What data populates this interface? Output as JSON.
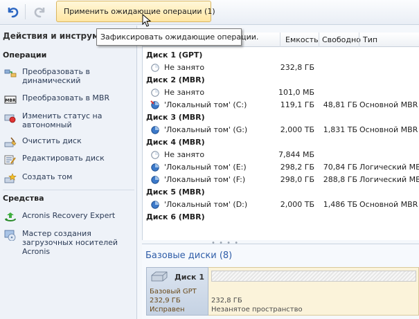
{
  "toolbar": {
    "apply_label": "Применить ожидающие операции (1)",
    "tooltip": "Зафиксировать ожидающие операции."
  },
  "sidebar": {
    "title": "Действия и инструменты",
    "sections": [
      {
        "title": "Операции",
        "items": [
          {
            "label": "Преобразовать в динамический",
            "icon": "convert-dynamic-icon"
          },
          {
            "label": "Преобразовать в MBR",
            "icon": "mbr-icon"
          },
          {
            "label": "Изменить статус на автономный",
            "icon": "offline-status-icon"
          },
          {
            "label": "Очистить диск",
            "icon": "clean-disk-icon"
          },
          {
            "label": "Редактировать диск",
            "icon": "edit-disk-icon"
          },
          {
            "label": "Создать том",
            "icon": "create-volume-icon"
          }
        ]
      },
      {
        "title": "Средства",
        "items": [
          {
            "label": "Acronis Recovery Expert",
            "icon": "recovery-expert-icon"
          },
          {
            "label": "Мастер создания загрузочных носителей Acronis",
            "icon": "boot-media-icon"
          }
        ]
      }
    ]
  },
  "columns": {
    "capacity": "Емкость",
    "free": "Свободно",
    "type": "Тип"
  },
  "rows": [
    {
      "kind": "disk",
      "name": "Диск 1 (GPT)"
    },
    {
      "kind": "vol",
      "name": "Не занято",
      "capacity": "232,8 ГБ",
      "free": "",
      "type": "",
      "icon": "unallocated-icon"
    },
    {
      "kind": "disk",
      "name": "Диск 2 (MBR)"
    },
    {
      "kind": "vol",
      "name": "Не занято",
      "capacity": "101,0 МБ",
      "free": "",
      "type": "",
      "icon": "unallocated-icon"
    },
    {
      "kind": "vol",
      "name": "'Локальный том' (C:)",
      "capacity": "119,1 ГБ",
      "free": "48,81 ГБ",
      "type": "Основной MBR",
      "icon": "system-volume-icon"
    },
    {
      "kind": "disk",
      "name": "Диск 3 (MBR)"
    },
    {
      "kind": "vol",
      "name": "'Локальный том' (G:)",
      "capacity": "2,000 ТБ",
      "free": "1,831 ТБ",
      "type": "Основной MBR",
      "icon": "volume-icon"
    },
    {
      "kind": "disk",
      "name": "Диск 4 (MBR)"
    },
    {
      "kind": "vol",
      "name": "Не занято",
      "capacity": "7,844 МБ",
      "free": "",
      "type": "",
      "icon": "unallocated-icon"
    },
    {
      "kind": "vol",
      "name": "'Локальный том' (E:)",
      "capacity": "298,2 ГБ",
      "free": "70,84 ГБ",
      "type": "Логический MBR",
      "icon": "volume-icon"
    },
    {
      "kind": "vol",
      "name": "'Локальный том' (F:)",
      "capacity": "298,0 ГБ",
      "free": "288,8 ГБ",
      "type": "Логический MBR",
      "icon": "volume-icon"
    },
    {
      "kind": "disk",
      "name": "Диск 5 (MBR)"
    },
    {
      "kind": "vol",
      "name": "'Локальный том' (D:)",
      "capacity": "2,000 ТБ",
      "free": "1,486 ТБ",
      "type": "Основной MBR",
      "icon": "volume-icon"
    },
    {
      "kind": "disk",
      "name": "Диск 6 (MBR)"
    }
  ],
  "basic": {
    "title": "Базовые диски (8)",
    "disk": {
      "name": "Диск 1",
      "line1": "Базовый GPT",
      "line2": "232,9 ГБ",
      "line3": "Исправен"
    },
    "unallocated": {
      "size": "232,8 ГБ",
      "label": "Незанятое пространство"
    }
  },
  "colors": {
    "accent": "#2f5da8",
    "apply_bg": "#ffe6a3"
  }
}
